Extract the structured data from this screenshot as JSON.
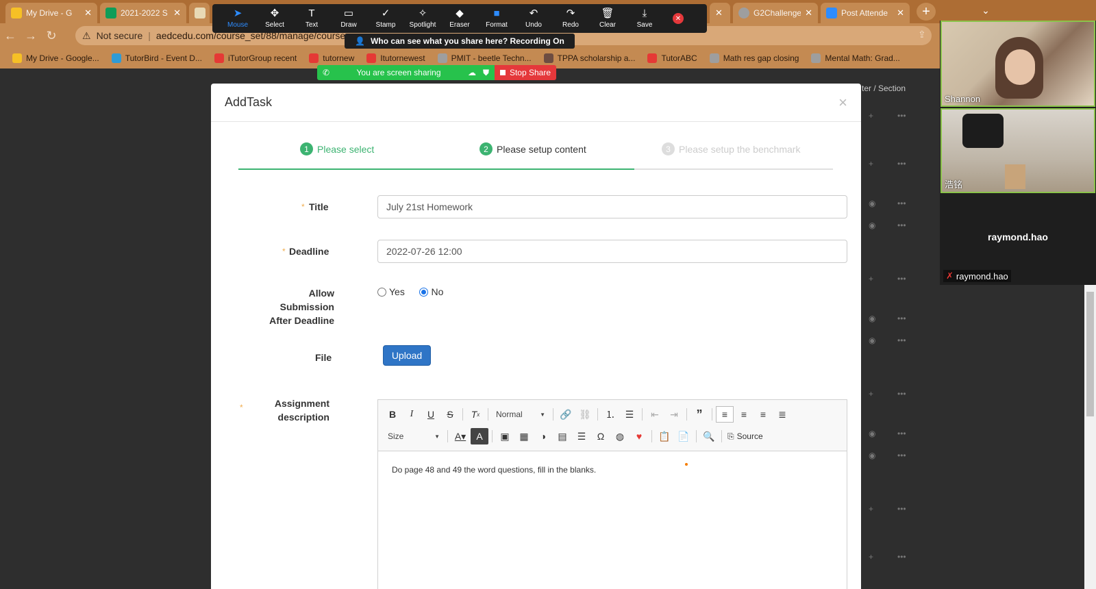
{
  "browser": {
    "tabs": [
      {
        "label": "My Drive - G",
        "color": "#f6c026"
      },
      {
        "label": "2021-2022 S",
        "color": "#0f9d58"
      },
      {
        "label": "",
        "color": "#e8d9b5"
      },
      {
        "label": "G2Challenge",
        "color": "#9e9e9e"
      },
      {
        "label": "Post Attende",
        "color": "#2d8cff"
      }
    ],
    "address": {
      "not_secure": "Not secure",
      "url": "aedcedu.com/course_set/88/manage/course"
    },
    "bookmarks": [
      {
        "label": "My Drive - Google...",
        "color": "#f6c026"
      },
      {
        "label": "TutorBird - Event D...",
        "color": "#2f9bd6"
      },
      {
        "label": "iTutorGroup recent",
        "color": "#e53935"
      },
      {
        "label": "tutornew",
        "color": "#e53935"
      },
      {
        "label": "Itutornewest",
        "color": "#e53935"
      },
      {
        "label": "PMIT - beetle Techn...",
        "color": "#9e9e9e"
      },
      {
        "label": "TPPA scholarship a...",
        "color": "#6d4c41"
      },
      {
        "label": "TutorABC",
        "color": "#e53935"
      },
      {
        "label": "Math res gap closing",
        "color": "#9e9e9e"
      },
      {
        "label": "Mental Math: Grad...",
        "color": "#9e9e9e"
      }
    ]
  },
  "zoom": {
    "tools": [
      {
        "label": "Mouse",
        "icon": "mouse-pointer-icon",
        "glyph": "➤"
      },
      {
        "label": "Select",
        "icon": "move-icon",
        "glyph": "✥"
      },
      {
        "label": "Text",
        "icon": "text-icon",
        "glyph": "T"
      },
      {
        "label": "Draw",
        "icon": "draw-icon",
        "glyph": "▭"
      },
      {
        "label": "Stamp",
        "icon": "stamp-icon",
        "glyph": "✓"
      },
      {
        "label": "Spotlight",
        "icon": "spotlight-icon",
        "glyph": "✧"
      },
      {
        "label": "Eraser",
        "icon": "eraser-icon",
        "glyph": "◆"
      },
      {
        "label": "Format",
        "icon": "format-icon",
        "glyph": "■"
      },
      {
        "label": "Undo",
        "icon": "undo-icon",
        "glyph": "↶"
      },
      {
        "label": "Redo",
        "icon": "redo-icon",
        "glyph": "↷"
      },
      {
        "label": "Clear",
        "icon": "trash-icon",
        "glyph": "🗑"
      },
      {
        "label": "Save",
        "icon": "save-icon",
        "glyph": "⤓"
      }
    ],
    "who_sees": "Who can see what you share here? Recording On",
    "sharing_text": "You are screen sharing",
    "stop_share": "Stop Share",
    "participants": [
      {
        "name": "Shannon"
      },
      {
        "name": "浩铭"
      },
      {
        "name": "raymond.hao",
        "display": "raymond.hao"
      }
    ]
  },
  "background": {
    "section_label": "ter / Section"
  },
  "modal": {
    "title": "AddTask",
    "close": "×",
    "steps": [
      {
        "num": "1",
        "label": "Please select"
      },
      {
        "num": "2",
        "label": "Please setup content"
      },
      {
        "num": "3",
        "label": "Please setup the benchmark"
      }
    ],
    "form": {
      "title_label": "Title",
      "title_value": "July 21st Homework",
      "deadline_label": "Deadline",
      "deadline_value": "2022-07-26 12:00",
      "allow_label_1": "Allow",
      "allow_label_2": "Submission",
      "allow_label_3": "After Deadline",
      "yes": "Yes",
      "no": "No",
      "file_label": "File",
      "upload": "Upload",
      "desc_label_1": "Assignment",
      "desc_label_2": "description",
      "required_mark": "*"
    },
    "editor": {
      "format_combo": "Normal",
      "size_combo": "Size",
      "source": "Source",
      "content": "Do page 48 and 49 the word questions, fill in the blanks."
    }
  }
}
